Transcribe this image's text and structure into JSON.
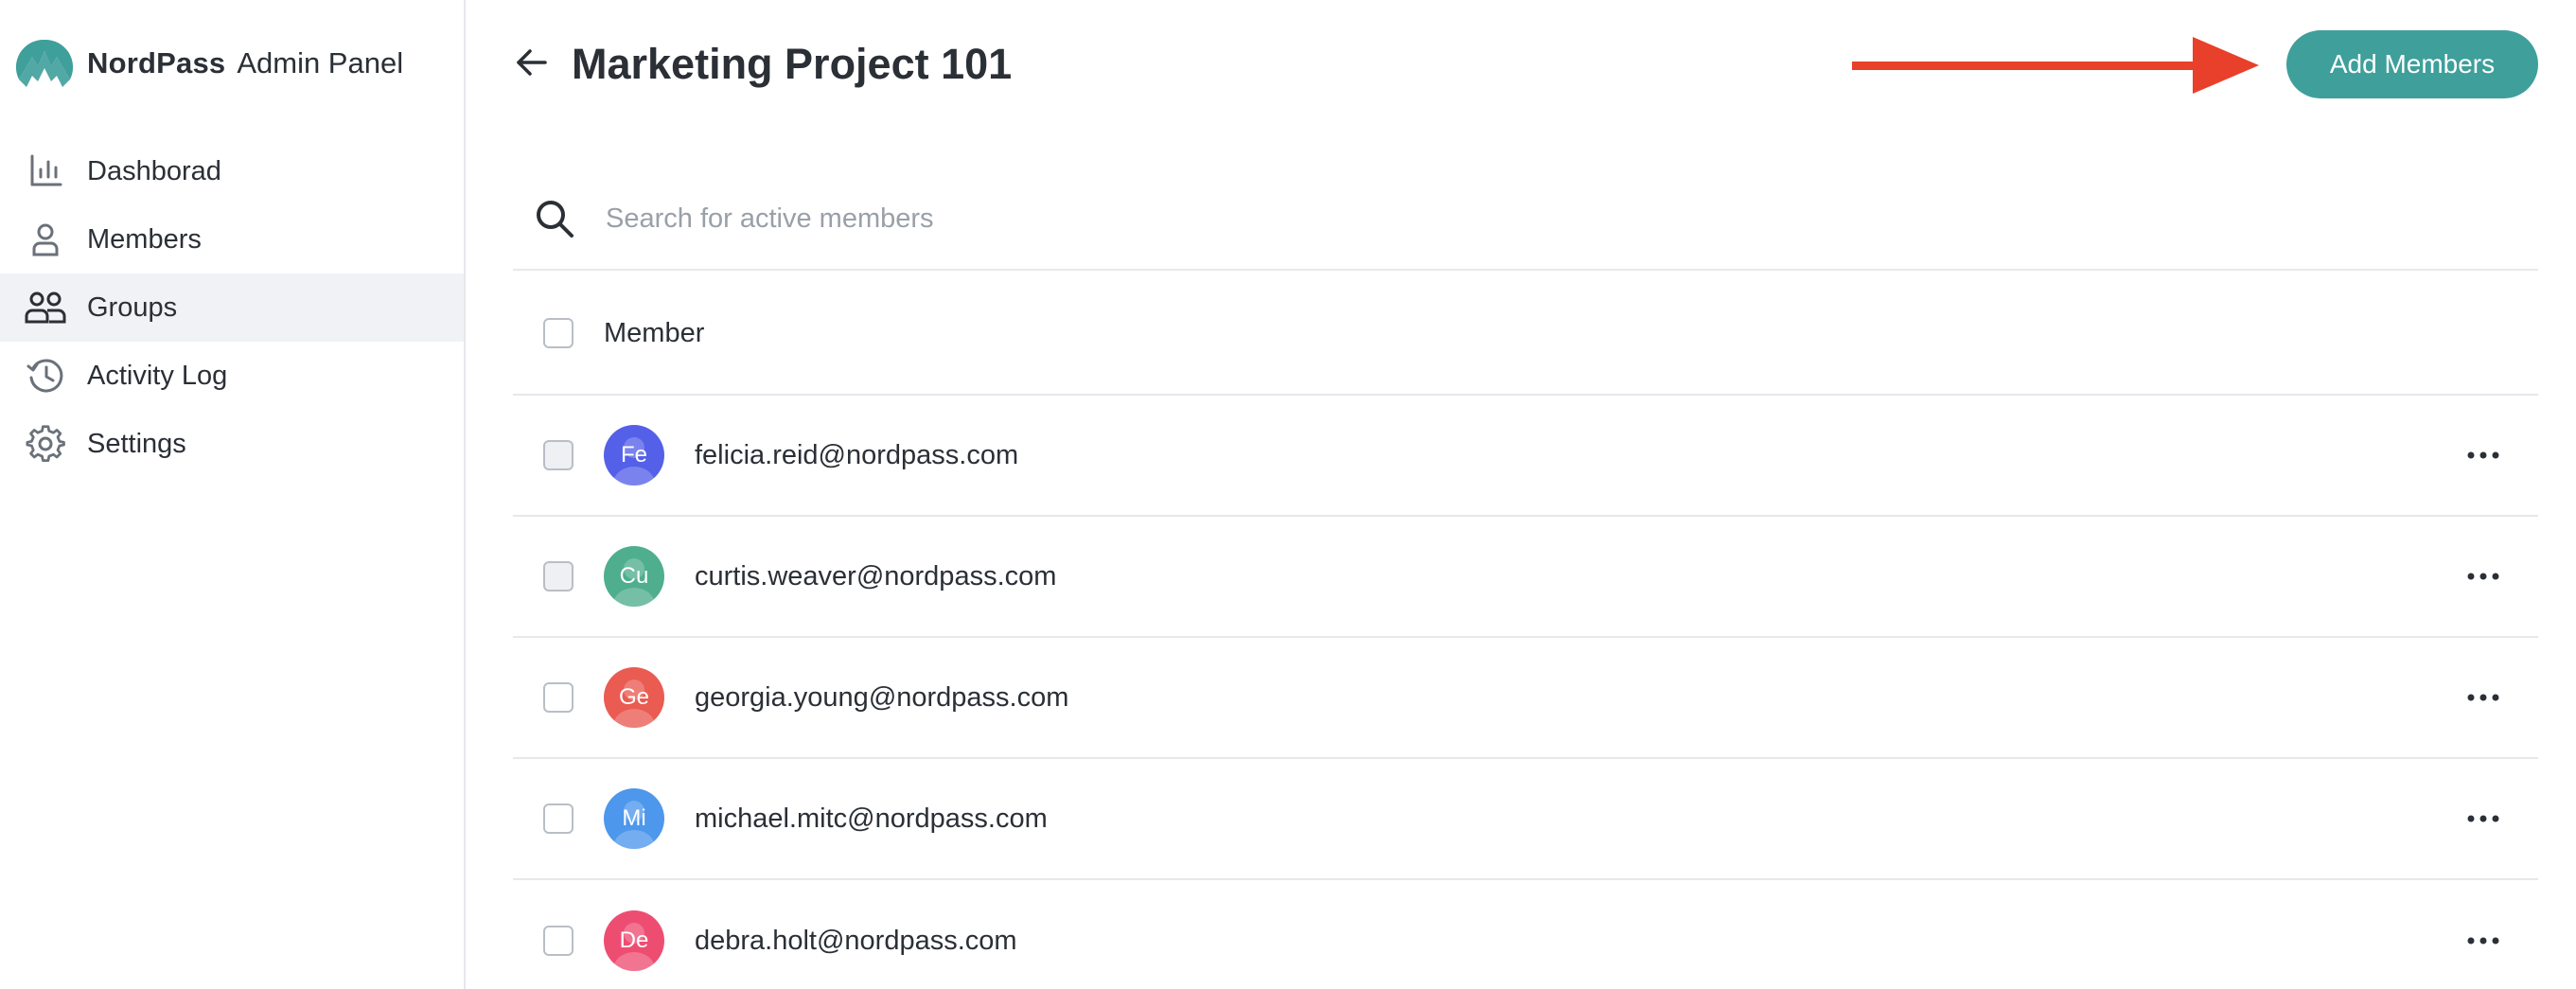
{
  "brand": {
    "name": "NordPass",
    "subtitle": "Admin Panel",
    "logo_icon": "nordpass-mountain-logo",
    "accent_color": "#3f9f9b"
  },
  "sidebar": {
    "items": [
      {
        "label": "Dashborad",
        "icon": "bar-chart-icon",
        "active": false
      },
      {
        "label": "Members",
        "icon": "person-icon",
        "active": false
      },
      {
        "label": "Groups",
        "icon": "people-icon",
        "active": true
      },
      {
        "label": "Activity Log",
        "icon": "history-icon",
        "active": false
      },
      {
        "label": "Settings",
        "icon": "gear-icon",
        "active": false
      }
    ]
  },
  "header": {
    "title": "Marketing Project 101",
    "back_icon": "arrow-left-icon",
    "add_button_label": "Add Members",
    "annotation_arrow_color": "#e8402a"
  },
  "search": {
    "placeholder": "Search for active members",
    "value": ""
  },
  "table": {
    "column_header": "Member",
    "rows": [
      {
        "initials": "Fe",
        "email": "felicia.reid@nordpass.com",
        "avatar_color": "#5560e8"
      },
      {
        "initials": "Cu",
        "email": "curtis.weaver@nordpass.com",
        "avatar_color": "#4fae8e"
      },
      {
        "initials": "Ge",
        "email": "georgia.young@nordpass.com",
        "avatar_color": "#ea5b52"
      },
      {
        "initials": "Mi",
        "email": "michael.mitc@nordpass.com",
        "avatar_color": "#4d97ec"
      },
      {
        "initials": "De",
        "email": "debra.holt@nordpass.com",
        "avatar_color": "#ee4d72"
      }
    ]
  }
}
